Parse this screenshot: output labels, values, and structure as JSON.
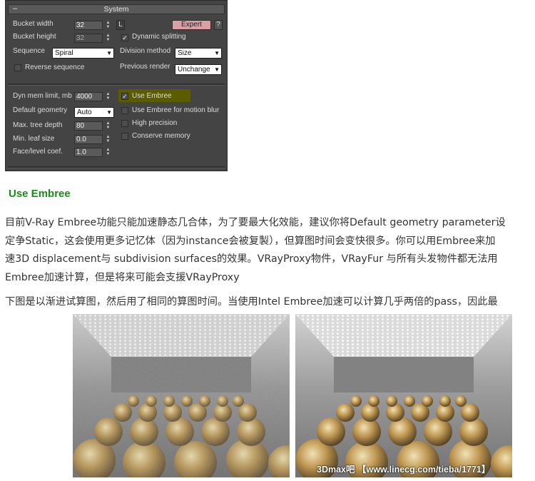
{
  "panel": {
    "title": "System",
    "collapse_symbol": "–",
    "bucket_width_label": "Bucket width",
    "bucket_width_value": "32",
    "bucket_height_label": "Bucket height",
    "bucket_height_value": "32",
    "lock_button": "L",
    "expert_button": "Expert",
    "help_button": "?",
    "dynamic_splitting_label": "Dynamic splitting",
    "dynamic_splitting_checked": true,
    "sequence_label": "Sequence",
    "sequence_value": "Spiral",
    "division_method_label": "Division method",
    "division_method_value": "Size",
    "reverse_sequence_label": "Reverse sequence",
    "previous_render_label": "Previous render",
    "previous_render_value": "Unchange",
    "dyn_mem_label": "Dyn mem limit, mb",
    "dyn_mem_value": "4000",
    "default_geometry_label": "Default geometry",
    "default_geometry_value": "Auto",
    "max_tree_depth_label": "Max. tree depth",
    "max_tree_depth_value": "80",
    "min_leaf_size_label": "Min. leaf size",
    "min_leaf_size_value": "0.0",
    "face_level_label": "Face/level coef.",
    "face_level_value": "1.0",
    "use_embree_label": "Use Embree",
    "use_embree_checked": true,
    "use_embree_motion_blur_label": "Use Embree for motion blur",
    "high_precision_label": "High precision",
    "conserve_memory_label": "Conserve memory",
    "colors": {
      "panel_bg": "#444444",
      "expert_button": "#d9a0a6",
      "highlight": "#5b5b00"
    }
  },
  "article": {
    "heading": "Use Embree",
    "paragraph1_lines": [
      "目前V-Ray Embree功能只能加速静态几合体，为了要最大化效能，建议你将Default geometry parameter设",
      "定争Static，这会使用更多记忆体（因为instance会被复製），但算图时间会变快很多。你可以用Embree来加",
      "速3D displacement与 subdivision surfaces的效果。VRayProxy物件，VRayFur 与所有头发物件都无法用",
      "Embree加速计算，但是将来可能会支援VRayProxy"
    ],
    "paragraph2": "下图是以渐进试算图，然后用了相同的算图时间。当使用Intel Embree加速可以计算几乎两倍的pass，因此最",
    "watermark": "3Dmax吧 【www.linecg.com/tieba/1771】",
    "heading_color": "#1a8a1a"
  }
}
